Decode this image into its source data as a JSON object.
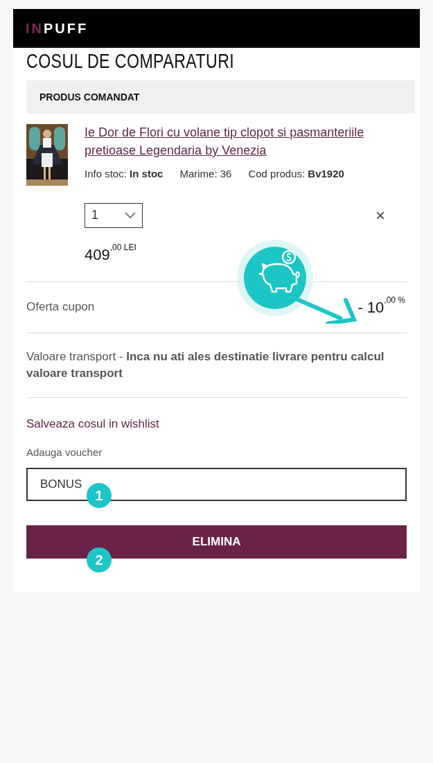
{
  "header": {
    "logo_accent": "IN",
    "logo_rest": "PUFF"
  },
  "title": "COSUL DE COMPARATURI",
  "section_heading": "PRODUS COMANDAT",
  "product": {
    "name": "Ie Dor de Flori cu volane tip clopot si pasmanteriile pretioase Legendaria by Venezia",
    "meta": [
      "Info stoc: **In stoc**",
      "Marime: 36",
      "Cod produs: **Bv1920**"
    ],
    "quantity": "1",
    "remove": "×",
    "price": "409$^{,00 LEI}$"
  },
  "coupon": {
    "label": "Oferta cupon",
    "value": "- 10$^{,00 %}$"
  },
  "transport": "Valoare transport - **Inca nu ati ales destinatie livrare pentru calcul valoare transport**",
  "wishlist_link": "Salveaza cosul in wishlist",
  "voucher": {
    "label": "Adauga voucher",
    "value": "BONUS",
    "badge": "1"
  },
  "remove_button": {
    "label": "ELIMINA",
    "badge": "2"
  }
}
